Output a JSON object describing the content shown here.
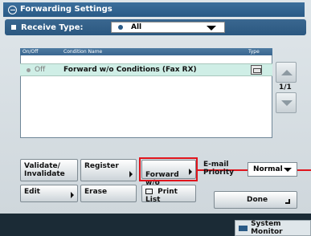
{
  "window": {
    "title": "Forwarding Settings"
  },
  "receive_type": {
    "label": "Receive Type:",
    "selected": "All"
  },
  "table": {
    "headers": [
      "On/Off",
      "Condition Name",
      "Type"
    ],
    "rows": [
      {
        "onoff": "Off",
        "name": "Forward w/o Conditions (Fax RX)",
        "type_icon": "fax-icon"
      }
    ]
  },
  "pager": {
    "page": "1/1"
  },
  "buttons": {
    "validate": "Validate/\nInvalidate",
    "register": "Register",
    "forward": "Forward w/o\nConditions",
    "edit": "Edit",
    "erase": "Erase",
    "print_list": "Print List",
    "done": "Done"
  },
  "email_priority": {
    "label": "E-mail\nPriority",
    "value": "Normal"
  },
  "status": {
    "system_monitor": "System Monitor"
  },
  "colors": {
    "accent": "#2a5a86",
    "highlight": "#e0141c",
    "row_selected": "#cfeee6"
  }
}
